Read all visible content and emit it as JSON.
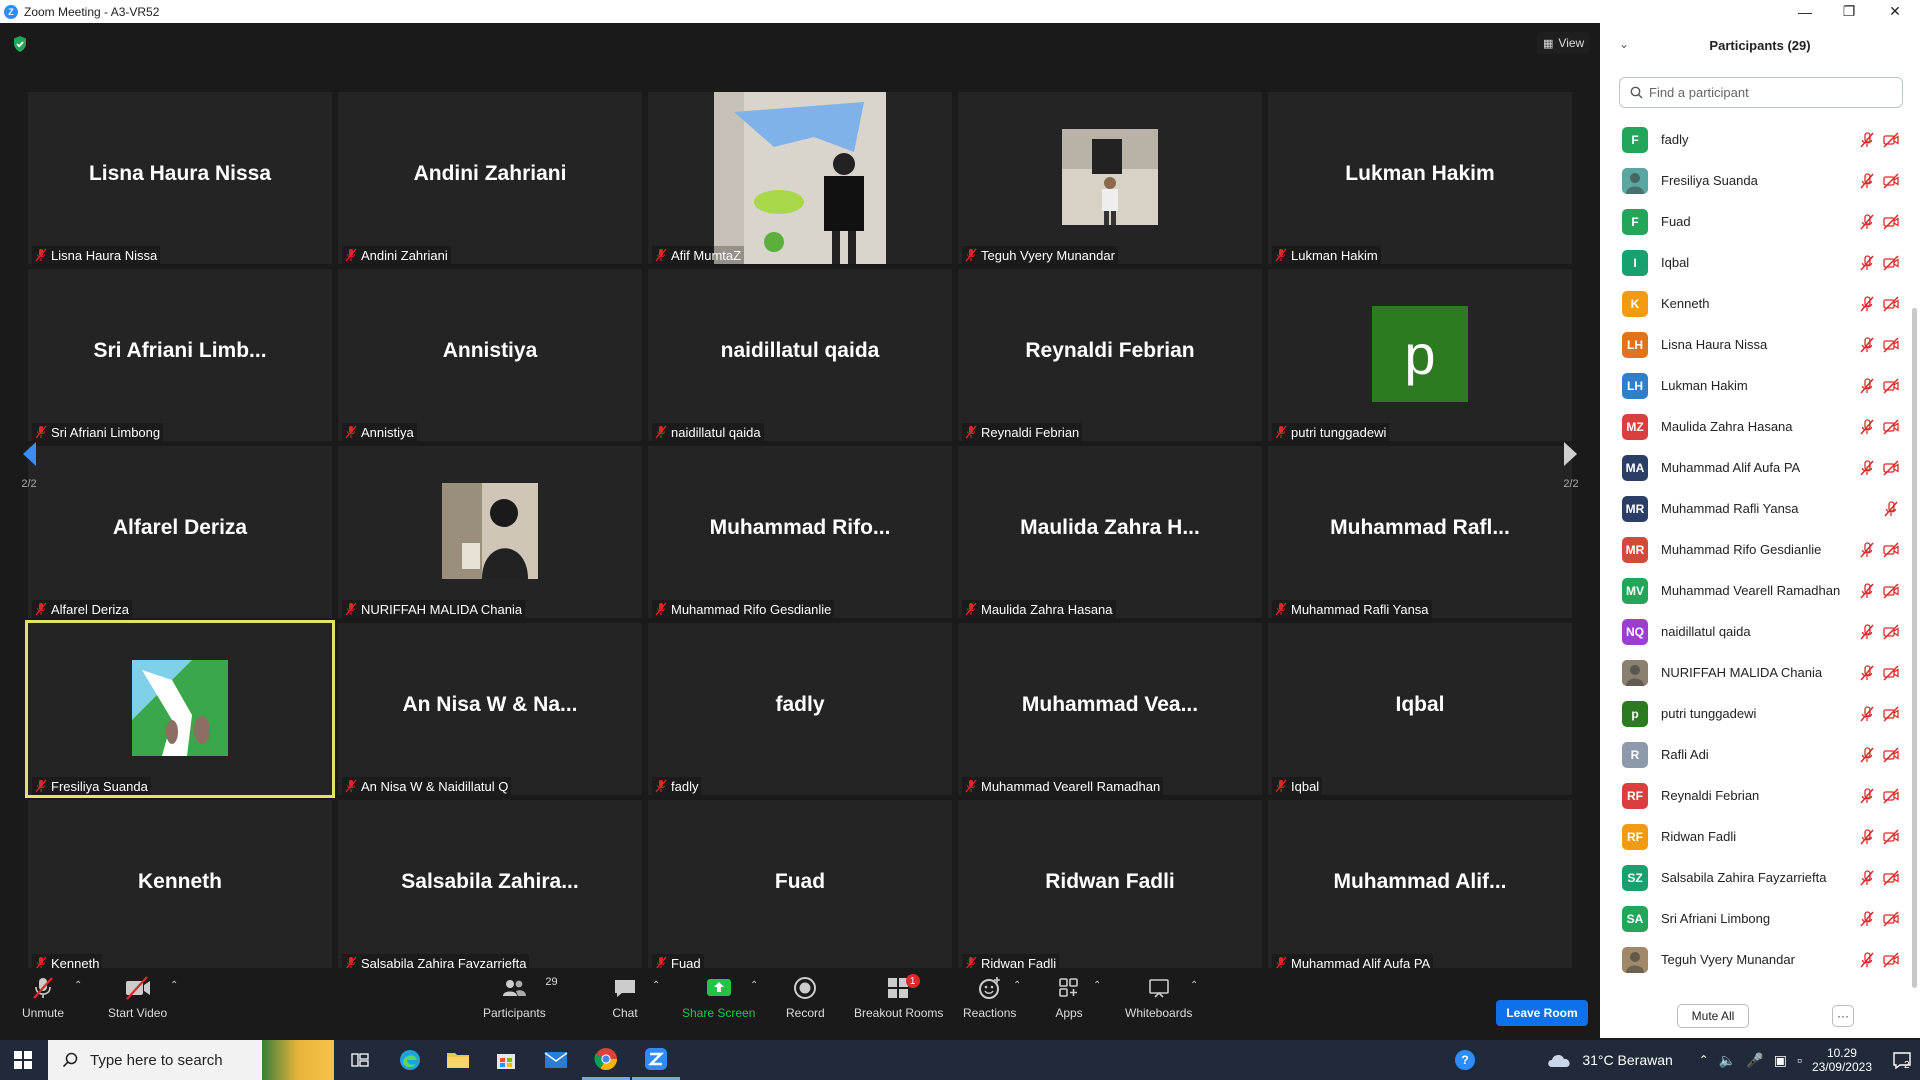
{
  "window": {
    "title": "Zoom Meeting - A3-VR52"
  },
  "meeting": {
    "view_label": "View",
    "page_indicator": "2/2",
    "tiles": [
      {
        "center": "Lisna Haura Nissa",
        "label": "Lisna Haura Nissa",
        "type": "name"
      },
      {
        "center": "Andini Zahriani",
        "label": "Andini Zahriani",
        "type": "name"
      },
      {
        "center": "",
        "label": "Afif MumtaZ",
        "type": "video"
      },
      {
        "center": "",
        "label": "Teguh Vyery Munandar",
        "type": "photo"
      },
      {
        "center": "Lukman Hakim",
        "label": "Lukman Hakim",
        "type": "name"
      },
      {
        "center": "Sri Afriani Limb...",
        "label": "Sri Afriani Limbong",
        "type": "name"
      },
      {
        "center": "Annistiya",
        "label": "Annistiya",
        "type": "name"
      },
      {
        "center": "naidillatul qaida",
        "label": "naidillatul qaida",
        "type": "name"
      },
      {
        "center": "Reynaldi Febrian",
        "label": "Reynaldi Febrian",
        "type": "name"
      },
      {
        "center": "p",
        "label": "putri tunggadewi",
        "type": "letter"
      },
      {
        "center": "Alfarel Deriza",
        "label": "Alfarel Deriza",
        "type": "name"
      },
      {
        "center": "",
        "label": "NURIFFAH MALIDA Chania",
        "type": "photo2"
      },
      {
        "center": "Muhammad  Rifo...",
        "label": "Muhammad Rifo Gesdianlie",
        "type": "name"
      },
      {
        "center": "Maulida Zahra H...",
        "label": "Maulida Zahra Hasana",
        "type": "name"
      },
      {
        "center": "Muhammad  Rafl...",
        "label": "Muhammad Rafli Yansa",
        "type": "name"
      },
      {
        "center": "",
        "label": "Fresiliya Suanda",
        "type": "waterfall"
      },
      {
        "center": "An Nisa W & Na...",
        "label": "An Nisa W & Naidillatul Q",
        "type": "name"
      },
      {
        "center": "fadly",
        "label": "fadly",
        "type": "name"
      },
      {
        "center": "Muhammad  Vea...",
        "label": "Muhammad Vearell Ramadhan",
        "type": "name"
      },
      {
        "center": "Iqbal",
        "label": "Iqbal",
        "type": "name"
      },
      {
        "center": "Kenneth",
        "label": "Kenneth",
        "type": "name"
      },
      {
        "center": "Salsabila  Zahira...",
        "label": "Salsabila Zahira Fayzarriefta",
        "type": "name"
      },
      {
        "center": "Fuad",
        "label": "Fuad",
        "type": "name"
      },
      {
        "center": "Ridwan Fadli",
        "label": "Ridwan Fadli",
        "type": "name"
      },
      {
        "center": "Muhammad  Alif...",
        "label": "Muhammad Alif Aufa PA",
        "type": "name"
      }
    ]
  },
  "toolbar": {
    "unmute": "Unmute",
    "start_video": "Start Video",
    "participants": "Participants",
    "participants_count": "29",
    "chat": "Chat",
    "share_screen": "Share Screen",
    "record": "Record",
    "breakout_rooms": "Breakout Rooms",
    "breakout_badge": "1",
    "reactions": "Reactions",
    "apps": "Apps",
    "whiteboards": "Whiteboards",
    "leave_room": "Leave Room"
  },
  "participants_panel": {
    "title": "Participants (29)",
    "search_placeholder": "Find a participant",
    "mute_all": "Mute All",
    "more": "···",
    "items": [
      {
        "initials": "F",
        "name": "fadly",
        "color": "#23a55a",
        "video_off": true
      },
      {
        "initials": "",
        "name": "Fresiliya Suanda",
        "color": "#5aa6a0",
        "video_off": true,
        "photo": true
      },
      {
        "initials": "F",
        "name": "Fuad",
        "color": "#23a55a",
        "video_off": true
      },
      {
        "initials": "I",
        "name": "Iqbal",
        "color": "#18a06e",
        "video_off": true
      },
      {
        "initials": "K",
        "name": "Kenneth",
        "color": "#f29b12",
        "video_off": true
      },
      {
        "initials": "LH",
        "name": "Lisna Haura Nissa",
        "color": "#e0741c",
        "video_off": true
      },
      {
        "initials": "LH",
        "name": "Lukman Hakim",
        "color": "#2f80c8",
        "video_off": true
      },
      {
        "initials": "MZ",
        "name": "Maulida Zahra Hasana",
        "color": "#d93f3f",
        "video_off": true
      },
      {
        "initials": "MA",
        "name": "Muhammad Alif Aufa PA",
        "color": "#2b3f66",
        "video_off": true
      },
      {
        "initials": "MR",
        "name": "Muhammad Rafli Yansa",
        "color": "#2b3f66",
        "video_off": false
      },
      {
        "initials": "MR",
        "name": "Muhammad Rifo Gesdianlie",
        "color": "#d44a3a",
        "video_off": true
      },
      {
        "initials": "MV",
        "name": "Muhammad Vearell Ramadhan",
        "color": "#23a55a",
        "video_off": true
      },
      {
        "initials": "NQ",
        "name": "naidillatul qaida",
        "color": "#9b3fd1",
        "video_off": true
      },
      {
        "initials": "",
        "name": "NURIFFAH MALIDA Chania",
        "color": "#8a7f70",
        "video_off": true,
        "photo": true
      },
      {
        "initials": "p",
        "name": "putri tunggadewi",
        "color": "#2d7a22",
        "video_off": true
      },
      {
        "initials": "R",
        "name": "Rafli Adi",
        "color": "#8c9aab",
        "video_off": true
      },
      {
        "initials": "RF",
        "name": "Reynaldi Febrian",
        "color": "#d93f3f",
        "video_off": true
      },
      {
        "initials": "RF",
        "name": "Ridwan Fadli",
        "color": "#f29b12",
        "video_off": true
      },
      {
        "initials": "SZ",
        "name": "Salsabila Zahira Fayzarriefta",
        "color": "#18a06e",
        "video_off": true
      },
      {
        "initials": "SA",
        "name": "Sri Afriani Limbong",
        "color": "#23a55a",
        "video_off": true
      },
      {
        "initials": "",
        "name": "Teguh Vyery Munandar",
        "color": "#a08868",
        "video_off": true,
        "photo": true
      }
    ]
  },
  "taskbar": {
    "search_placeholder": "Type here to search",
    "weather": "31°C  Berawan",
    "time": "10.29",
    "date": "23/09/2023",
    "notification_count": "2"
  },
  "colors": {
    "accent": "#0e71eb",
    "muted_red": "#e02828",
    "active_speaker": "#e3e26a",
    "share_green": "#23c445"
  }
}
